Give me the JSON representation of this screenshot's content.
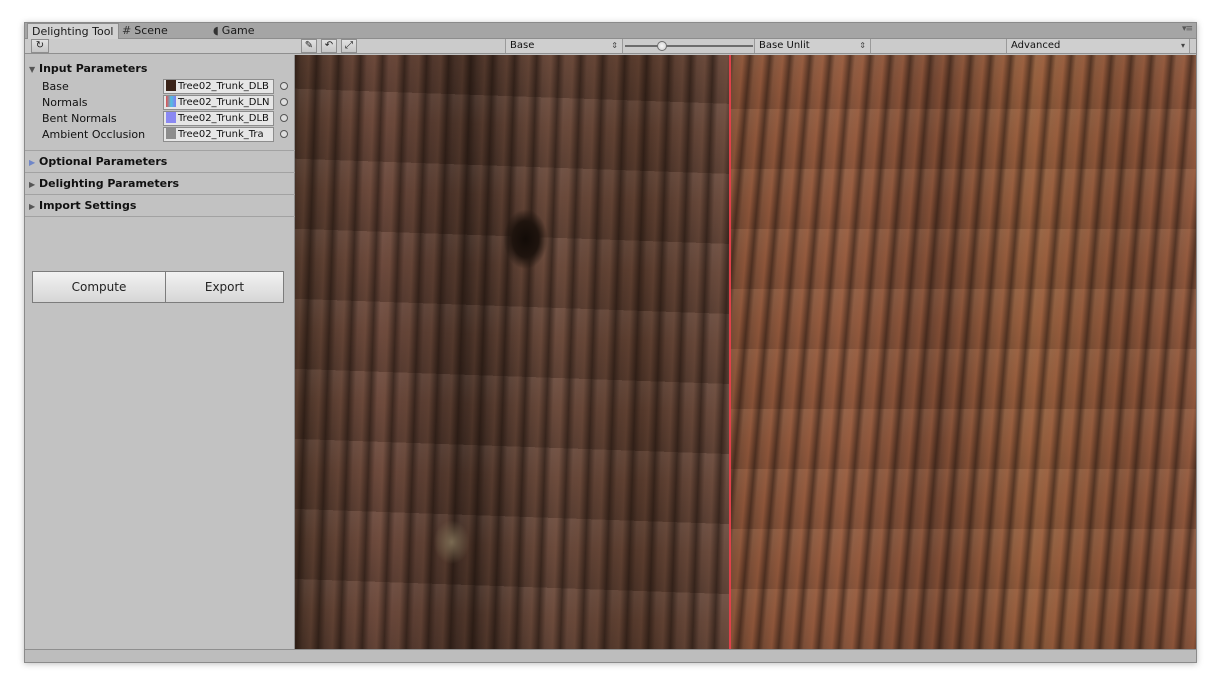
{
  "tabs": [
    {
      "label": "Delighting Tool",
      "icon": ""
    },
    {
      "label": "Scene",
      "icon": "scene-grid-icon"
    },
    {
      "label": "Game",
      "icon": "game-pacman-icon"
    }
  ],
  "toolbar": {
    "base_view": "Base",
    "right_view": "Base Unlit",
    "mode": "Advanced"
  },
  "sections": {
    "input": {
      "title": "Input Parameters",
      "rows": [
        {
          "label": "Base",
          "value": "Tree02_Trunk_DLB",
          "swatch": "#3a2318"
        },
        {
          "label": "Normals",
          "value": "Tree02_Trunk_DLN",
          "swatch": "#7f7cf0"
        },
        {
          "label": "Bent Normals",
          "value": "Tree02_Trunk_DLB",
          "swatch": "#8a88f2"
        },
        {
          "label": "Ambient Occlusion",
          "value": "Tree02_Trunk_Tra",
          "swatch": "#8d8d8d"
        }
      ]
    },
    "optional": {
      "title": "Optional Parameters"
    },
    "delighting": {
      "title": "Delighting Parameters"
    },
    "import": {
      "title": "Import Settings"
    }
  },
  "actions": {
    "compute": "Compute",
    "export": "Export"
  },
  "colors": {
    "split_line": "#e0404a",
    "panel_bg": "#c2c2c2"
  }
}
